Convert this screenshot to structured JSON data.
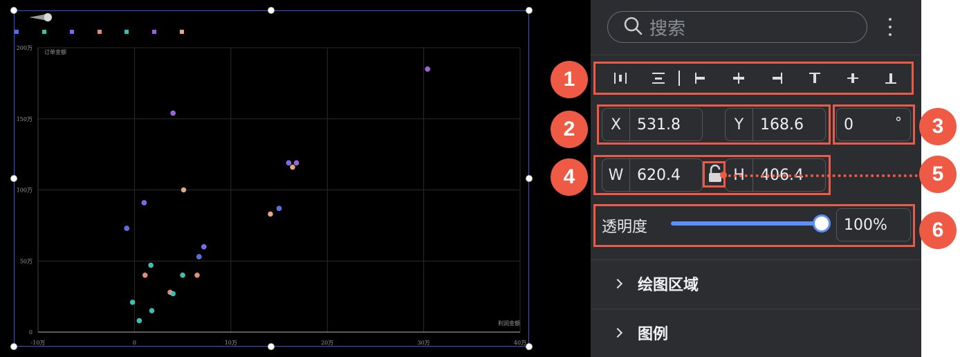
{
  "search": {
    "placeholder": "搜索"
  },
  "transform": {
    "x_label": "X",
    "x_value": "531.8",
    "y_label": "Y",
    "y_value": "168.6",
    "rotation_value": "0",
    "rotation_unit": "°",
    "w_label": "W",
    "w_value": "620.4",
    "h_label": "H",
    "h_value": "406.4"
  },
  "opacity": {
    "label": "透明度",
    "value": "100%",
    "level": 1.0
  },
  "sections": [
    {
      "label": "绘图区域"
    },
    {
      "label": "图例"
    }
  ],
  "badges": [
    "1",
    "2",
    "3",
    "4",
    "5",
    "6"
  ],
  "icons": {
    "search": "search-icon",
    "more": "more-vertical-icon",
    "lock": "lock-open-icon",
    "align": [
      "distribute-horizontal-icon",
      "distribute-vertical-icon",
      "align-left-icon",
      "align-center-horizontal-icon",
      "align-right-icon",
      "align-top-icon",
      "align-middle-vertical-icon",
      "align-bottom-icon"
    ]
  },
  "colors": {
    "accent": "#5b8ff9",
    "annotation": "#ef5a45",
    "selection": "#3a56d4"
  },
  "chart_data": {
    "type": "scatter",
    "xlabel": "利润金额",
    "ylabel": "订单金额",
    "x_ticks": [
      "-10万",
      "0",
      "10万",
      "20万",
      "30万",
      "40万"
    ],
    "y_ticks": [
      "0",
      "50万",
      "100万",
      "150万",
      "200万"
    ],
    "xlim": [
      -100000,
      400000
    ],
    "ylim": [
      0,
      2000000
    ],
    "grid": true,
    "legend_colors": [
      "#4a6cf7",
      "#2ec4b6",
      "#7b61ff",
      "#e8896b",
      "#2ec4b6",
      "#9b5de5",
      "#e8a87c"
    ],
    "points": [
      {
        "x": -8000,
        "y": 730000,
        "color": "#4a6cf7"
      },
      {
        "x": -2000,
        "y": 210000,
        "color": "#2ec4b6"
      },
      {
        "x": 5000,
        "y": 80000,
        "color": "#2ec4b6"
      },
      {
        "x": 10000,
        "y": 910000,
        "color": "#7b61ff"
      },
      {
        "x": 11000,
        "y": 400000,
        "color": "#e8896b"
      },
      {
        "x": 17000,
        "y": 470000,
        "color": "#2ec4b6"
      },
      {
        "x": 18000,
        "y": 150000,
        "color": "#2ec4b6"
      },
      {
        "x": 37000,
        "y": 280000,
        "color": "#e8896b"
      },
      {
        "x": 40000,
        "y": 1540000,
        "color": "#9b5de5"
      },
      {
        "x": 40000,
        "y": 270000,
        "color": "#2ec4b6"
      },
      {
        "x": 50000,
        "y": 400000,
        "color": "#2ec4b6"
      },
      {
        "x": 51000,
        "y": 1000000,
        "color": "#e8a87c"
      },
      {
        "x": 65000,
        "y": 400000,
        "color": "#e8896b"
      },
      {
        "x": 67000,
        "y": 530000,
        "color": "#4a6cf7"
      },
      {
        "x": 72000,
        "y": 600000,
        "color": "#7b61ff"
      },
      {
        "x": 141000,
        "y": 830000,
        "color": "#e8a87c"
      },
      {
        "x": 150000,
        "y": 870000,
        "color": "#4a6cf7"
      },
      {
        "x": 160000,
        "y": 1190000,
        "color": "#7b61ff"
      },
      {
        "x": 164000,
        "y": 1160000,
        "color": "#e8a87c"
      },
      {
        "x": 168000,
        "y": 1190000,
        "color": "#9b5de5"
      },
      {
        "x": 304000,
        "y": 1850000,
        "color": "#9b5de5"
      }
    ]
  }
}
